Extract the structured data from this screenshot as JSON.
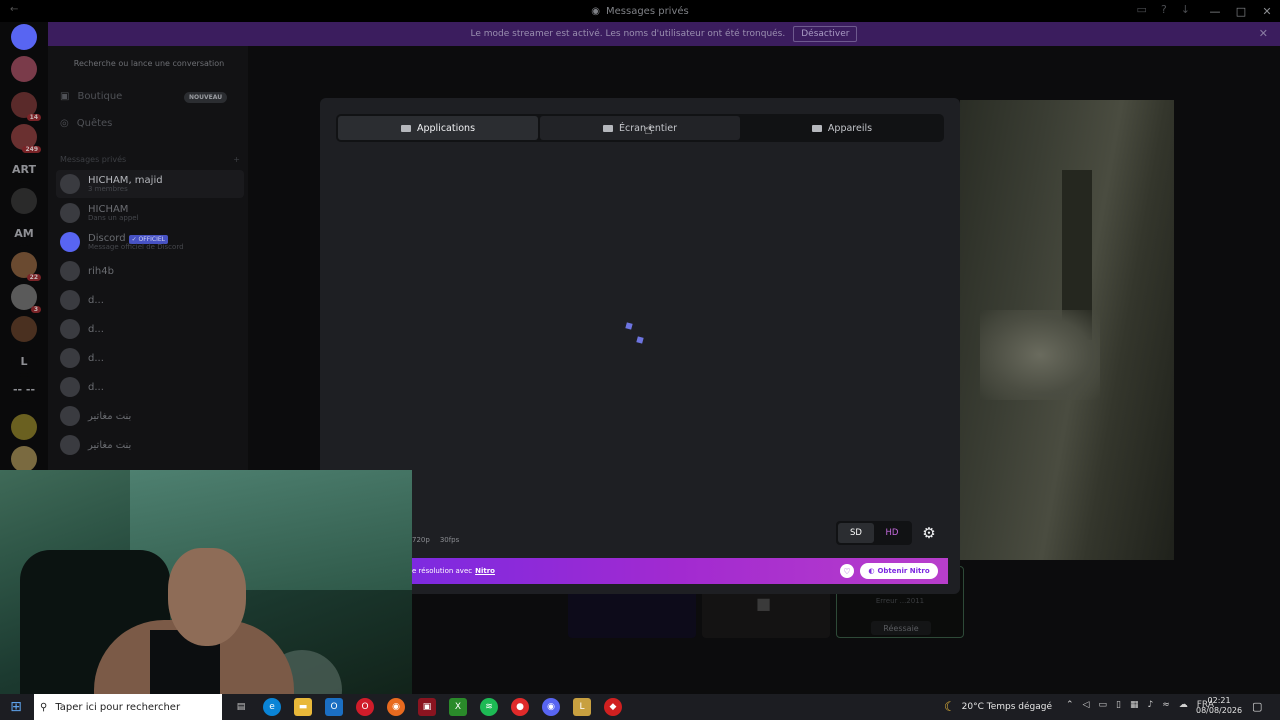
{
  "window": {
    "title": "Messages privés",
    "controls": [
      "—",
      "□",
      "✕"
    ]
  },
  "banner": {
    "text": "Le mode streamer est activé. Les noms d'utilisateur ont été tronqués.",
    "button": "Désactiver"
  },
  "guilds": [
    {
      "label": "",
      "badge": "",
      "color": "#5865f2"
    },
    {
      "label": "",
      "badge": "",
      "color": "#7a3b4a"
    },
    {
      "label": "",
      "badge": "14",
      "color": "#5a2a2a"
    },
    {
      "label": "",
      "badge": "249",
      "color": "#6a3030"
    },
    {
      "label": "ART",
      "badge": "",
      "color": "#0a0a0b"
    },
    {
      "label": "",
      "badge": "",
      "color": "#2a2a2a"
    },
    {
      "label": "AM",
      "badge": "",
      "color": "#0a0a0b"
    },
    {
      "label": "",
      "badge": "22",
      "color": "#6a4a30"
    },
    {
      "label": "",
      "badge": "3",
      "color": "#5a5a5a"
    },
    {
      "label": "",
      "badge": "",
      "color": "#4a3020"
    },
    {
      "label": "L",
      "badge": "",
      "color": "#0a0a0b"
    },
    {
      "label": "-- --",
      "badge": "",
      "color": "#0a0a0b"
    },
    {
      "label": "",
      "badge": "",
      "color": "#6a6020"
    },
    {
      "label": "",
      "badge": "",
      "color": "#7a6a40"
    }
  ],
  "dm": {
    "search": "Recherche ou lance une conversation",
    "nav": [
      {
        "label": "Boutique",
        "badge": "NOUVEAU"
      },
      {
        "label": "Quêtes",
        "badge": ""
      }
    ],
    "header": "Messages privés",
    "header_add": "+",
    "items": [
      {
        "name": "HICHAM, majid",
        "sub": "3 membres",
        "tag": ""
      },
      {
        "name": "HICHAM",
        "sub": "Dans un appel",
        "tag": ""
      },
      {
        "name": "Discord",
        "sub": "Message officiel de Discord",
        "tag": "✓ OFFICIEL"
      },
      {
        "name": "rih4b",
        "sub": "",
        "tag": ""
      },
      {
        "name": "d...",
        "sub": "",
        "tag": ""
      },
      {
        "name": "d...",
        "sub": "",
        "tag": ""
      },
      {
        "name": "d...",
        "sub": "",
        "tag": ""
      },
      {
        "name": "d...",
        "sub": "",
        "tag": ""
      },
      {
        "name": "بنت مغاتير",
        "sub": "",
        "tag": ""
      },
      {
        "name": "بنت مغاتير",
        "sub": "",
        "tag": ""
      }
    ]
  },
  "modal": {
    "tabs": [
      {
        "label": "Applications",
        "icon": "application-icon"
      },
      {
        "label": "Écran entier",
        "icon": "monitor-icon"
      },
      {
        "label": "Appareils",
        "icon": "camera-icon"
      }
    ],
    "quality_info": [
      "720p",
      "30fps"
    ],
    "quality": {
      "sd": "SD",
      "hd": "HD"
    },
    "nitro": {
      "text": "e résolution avec",
      "link": "Nitro",
      "button": "Obtenir Nitro"
    }
  },
  "tiles": {
    "error": "Erreur ...2011",
    "retry": "Réessaie"
  },
  "taskbar": {
    "search": "Taper ici pour rechercher",
    "weather": "20°C  Temps dégagé",
    "lang": "FRA",
    "time": "02:21",
    "date": "08/08/2026"
  },
  "colors": {
    "accent": "#5865f2",
    "nitro": "#a22ad0",
    "banner": "#3b1d5e"
  }
}
